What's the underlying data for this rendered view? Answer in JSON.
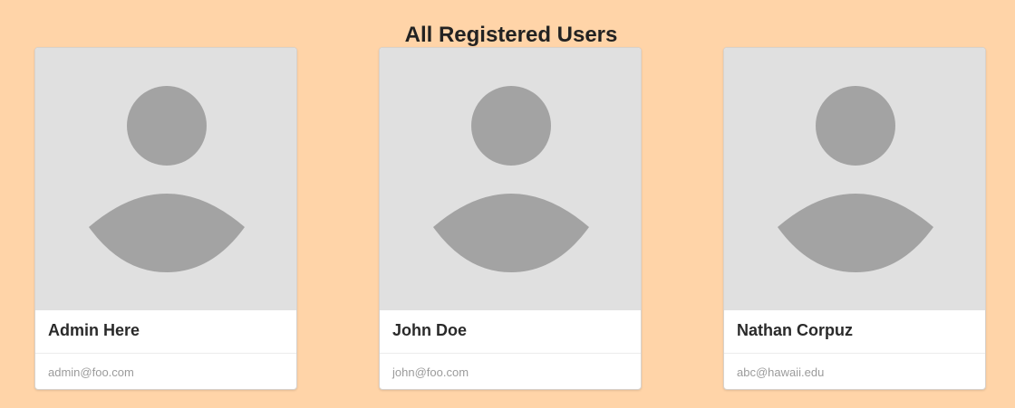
{
  "page": {
    "title": "All Registered Users"
  },
  "colors": {
    "background": "#ffd4a8",
    "avatar_bg": "#e0e0e0",
    "avatar_figure": "#a3a3a3"
  },
  "users": [
    {
      "name": "Admin Here",
      "email": "admin@foo.com",
      "avatar_icon": "user-placeholder-icon"
    },
    {
      "name": "John Doe",
      "email": "john@foo.com",
      "avatar_icon": "user-placeholder-icon"
    },
    {
      "name": "Nathan Corpuz",
      "email": "abc@hawaii.edu",
      "avatar_icon": "user-placeholder-icon"
    }
  ]
}
